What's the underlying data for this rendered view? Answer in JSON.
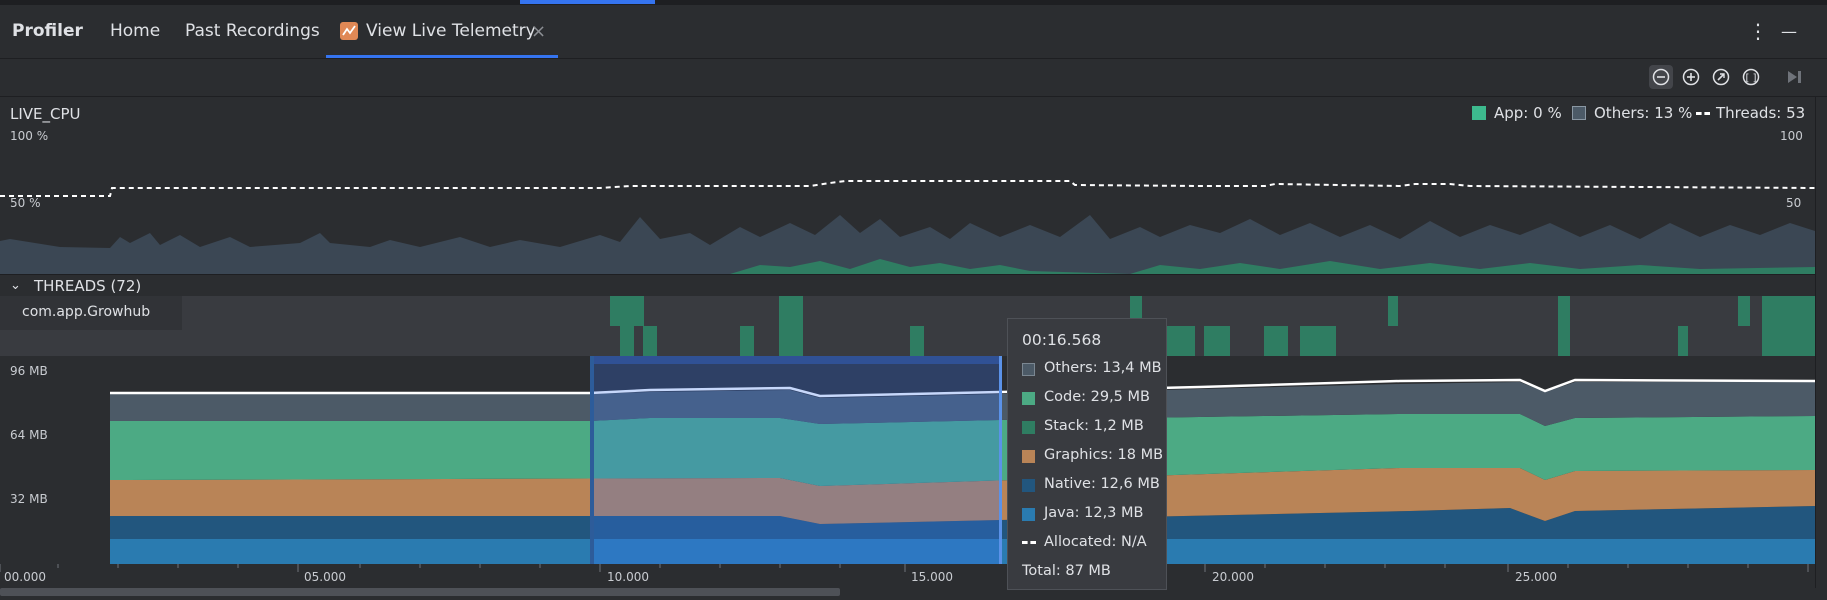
{
  "tabs": {
    "profiler": "Profiler",
    "home": "Home",
    "past": "Past Recordings",
    "live": "View Live Telemetry",
    "close": "×"
  },
  "menu": {
    "more": "⋮",
    "minimize": "—"
  },
  "cpu": {
    "title": "LIVE_CPU",
    "y_top": "100 %",
    "y_mid": "50 %",
    "y_right_top": "100",
    "y_right_mid": "50",
    "legend": {
      "app": "App: 0 %",
      "others": "Others: 13 %",
      "threads": "Threads: 53"
    }
  },
  "threads": {
    "header": "THREADS (72)",
    "name": "com.app.Growhub"
  },
  "memory": {
    "y96": "96 MB",
    "y64": "64 MB",
    "y32": "32 MB"
  },
  "axis": [
    "00.000",
    "05.000",
    "10.000",
    "15.000",
    "20.000",
    "25.000"
  ],
  "tooltip": {
    "time": "00:16.568",
    "others": "Others: 13,4 MB",
    "code": "Code: 29,5 MB",
    "stack": "Stack: 1,2 MB",
    "graphics": "Graphics: 18 MB",
    "native": "Native: 12,6 MB",
    "java": "Java: 12,3 MB",
    "allocated": "Allocated: N/A",
    "total": "Total: 87 MB"
  },
  "colors": {
    "accent": "#3574f0",
    "app": "#3dba8e",
    "others": "#4c5a67",
    "code": "#4caa84",
    "stack": "#2f7d62",
    "graphics": "#b98457",
    "native": "#22567e",
    "java": "#2a7bb0",
    "selection": "#3574f0"
  }
}
